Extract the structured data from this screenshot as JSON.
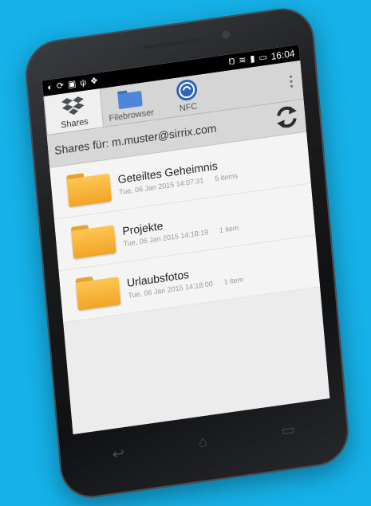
{
  "status_bar": {
    "time": "16:04"
  },
  "tabs": [
    {
      "label": "Shares",
      "icon": "dropbox-icon"
    },
    {
      "label": "Filebrowser",
      "icon": "folder-icon"
    },
    {
      "label": "NFC",
      "icon": "nfc-icon"
    }
  ],
  "account_bar": {
    "text": "Shares für: m.muster@sirrix.com",
    "sync_icon": "sync-icon"
  },
  "items": [
    {
      "name": "Geteiltes Geheimnis",
      "date": "Tue, 06 Jan 2015 14:07:31",
      "count": "5 items"
    },
    {
      "name": "Projekte",
      "date": "Tue, 06 Jan 2015 14:18:19",
      "count": "1 item"
    },
    {
      "name": "Urlaubsfotos",
      "date": "Tue, 06 Jan 2015 14:18:00",
      "count": "1 item"
    }
  ],
  "colors": {
    "background": "#15b1e8",
    "folder": "#f5b03a",
    "phone": "#1b1c1e"
  }
}
